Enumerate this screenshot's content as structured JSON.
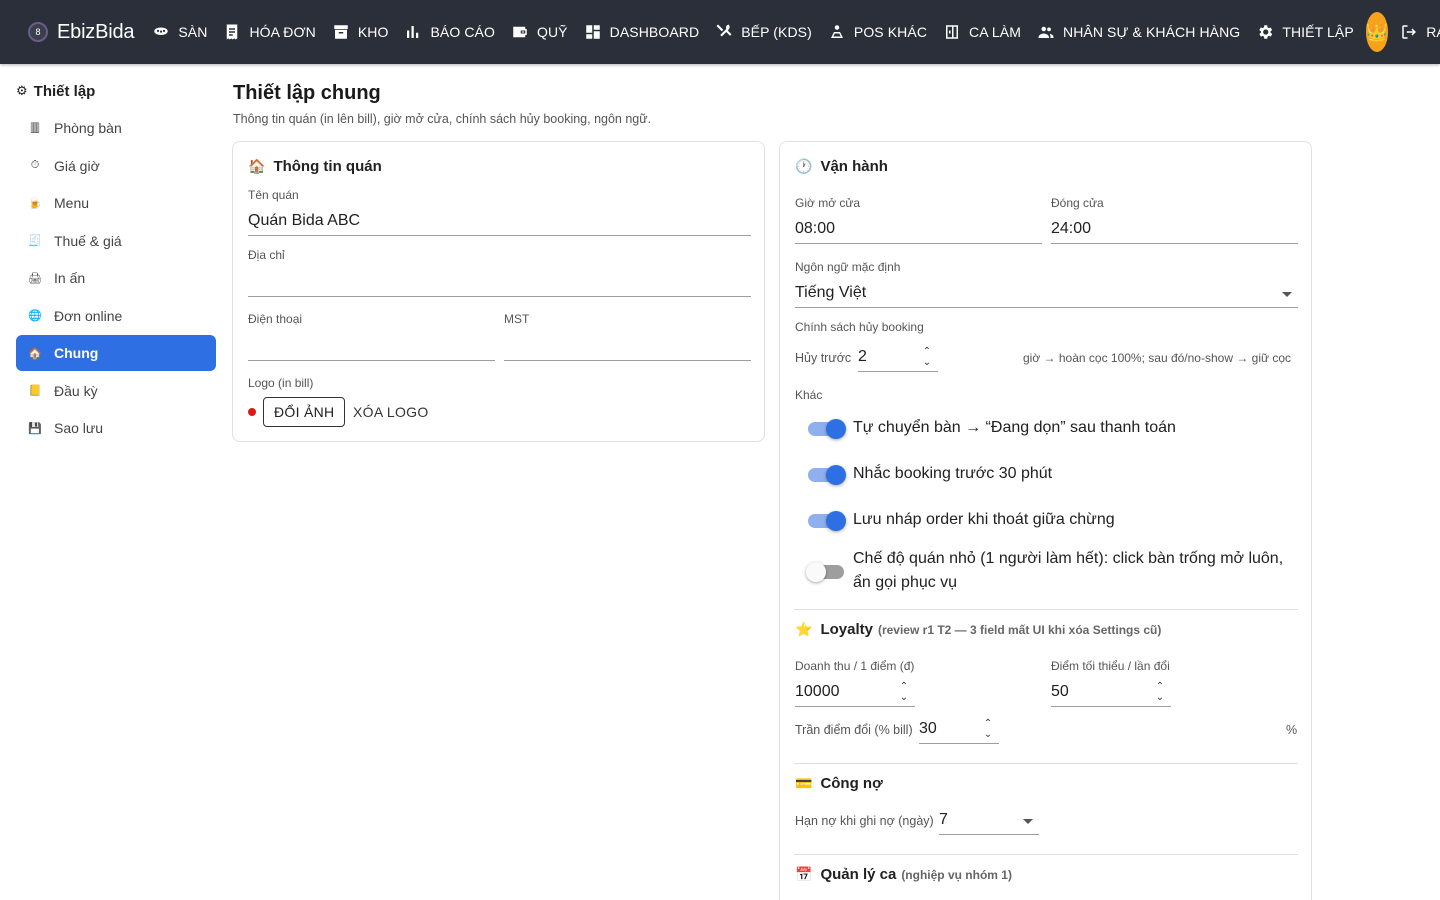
{
  "app": {
    "name": "EbizBida"
  },
  "nav": [
    {
      "label": "SÀN",
      "icon": "billiard-icon"
    },
    {
      "label": "HÓA ĐƠN",
      "icon": "receipt-icon"
    },
    {
      "label": "KHO",
      "icon": "archive-icon"
    },
    {
      "label": "BÁO CÁO",
      "icon": "bar-chart-icon"
    },
    {
      "label": "QUỸ",
      "icon": "wallet-icon"
    },
    {
      "label": "DASHBOARD",
      "icon": "dashboard-icon"
    },
    {
      "label": "BẾP (KDS)",
      "icon": "utensils-icon"
    },
    {
      "label": "POS KHÁC",
      "icon": "person-pos-icon"
    },
    {
      "label": "CA LÀM",
      "icon": "shift-icon"
    },
    {
      "label": "NHÂN SỰ & KHÁCH HÀNG",
      "icon": "people-icon"
    },
    {
      "label": "THIẾT LẬP",
      "icon": "gear-icon"
    }
  ],
  "logout_label": "RA",
  "sidebar": {
    "title": "Thiết lập",
    "items": [
      {
        "label": "Phòng bàn",
        "glyph": "🀫",
        "active": false
      },
      {
        "label": "Giá giờ",
        "glyph": "⏱",
        "active": false
      },
      {
        "label": "Menu",
        "glyph": "🍺",
        "active": false
      },
      {
        "label": "Thuế & giá",
        "glyph": "🧾",
        "active": false
      },
      {
        "label": "In ấn",
        "glyph": "🖨",
        "active": false
      },
      {
        "label": "Đơn online",
        "glyph": "🌐",
        "active": false
      },
      {
        "label": "Chung",
        "glyph": "🏠",
        "active": true
      },
      {
        "label": "Đầu kỳ",
        "glyph": "📒",
        "active": false
      },
      {
        "label": "Sao lưu",
        "glyph": "💾",
        "active": false
      }
    ]
  },
  "page": {
    "title": "Thiết lập chung",
    "subtitle": "Thông tin quán (in lên bill), giờ mở cửa, chính sách hủy booking, ngôn ngữ."
  },
  "info": {
    "heading": "Thông tin quán",
    "name_label": "Tên quán",
    "name_value": "Quán Bida ABC",
    "address_label": "Địa chỉ",
    "address_value": "",
    "phone_label": "Điện thoại",
    "phone_value": "",
    "tax_label": "MST",
    "tax_value": "",
    "logo_label": "Logo (in bill)",
    "change_logo": "ĐỔI ẢNH",
    "remove_logo": "XÓA LOGO"
  },
  "ops": {
    "heading": "Vận hành",
    "open_label": "Giờ mở cửa",
    "open_value": "08:00",
    "close_label": "Đóng cửa",
    "close_value": "24:00",
    "lang_label": "Ngôn ngữ mặc định",
    "lang_value": "Tiếng Việt",
    "cancel_label": "Chính sách hủy booking",
    "cancel_before_label": "Hủy trước",
    "cancel_before_value": "2",
    "cancel_hint": "giờ → hoàn cọc 100%; sau đó/no-show → giữ cọc",
    "other_label": "Khác",
    "toggles": [
      {
        "label": "Tự chuyển bàn → “Đang dọn” sau thanh toán",
        "on": true
      },
      {
        "label": "Nhắc booking trước 30 phút",
        "on": true
      },
      {
        "label": "Lưu nháp order khi thoát giữa chừng",
        "on": true
      },
      {
        "label": "Chế độ quán nhỏ (1 người làm hết): click bàn trống mở luôn, ẩn gọi phục vụ",
        "on": false
      }
    ]
  },
  "loyalty": {
    "heading": "Loyalty",
    "note": "(review r1 T2 — 3 field mất UI khi xóa Settings cũ)",
    "rev_label": "Doanh thu / 1 điểm (đ)",
    "rev_value": "10000",
    "min_label": "Điểm tối thiểu / lần đổi",
    "min_value": "50",
    "cap_label": "Trần điểm đổi (% bill)",
    "cap_value": "30",
    "cap_unit": "%"
  },
  "debt": {
    "heading": "Công nợ",
    "limit_label": "Hạn nợ khi ghi nợ (ngày)",
    "limit_value": "7"
  },
  "shift": {
    "heading": "Quản lý ca",
    "note": "(nghiệp vụ nhóm 1)"
  },
  "colors": {
    "topbar": "#2a2f3a",
    "accent": "#2f6fe4",
    "avatar": "#f7a21b"
  }
}
